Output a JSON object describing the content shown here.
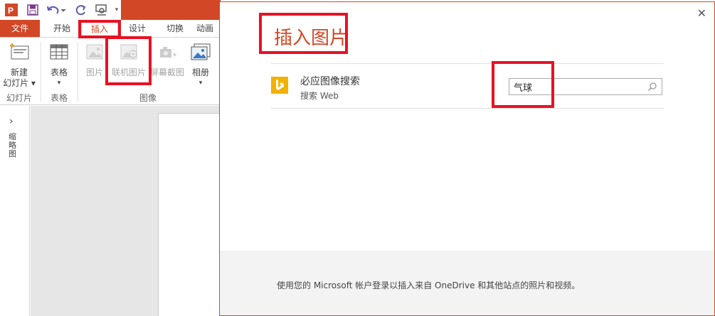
{
  "tabs": {
    "file": "文件",
    "home": "开始",
    "insert": "插入",
    "design": "设计",
    "transitions": "切换",
    "animations": "动画"
  },
  "ribbon": {
    "new_slide": [
      "新建",
      "幻灯片 ▾"
    ],
    "table": [
      "表格",
      "▾"
    ],
    "pictures": "图片",
    "online_pictures": "联机图片",
    "screenshot": "屏幕截图",
    "album": [
      "相册",
      "▾"
    ],
    "groups": {
      "slides": "幻灯片",
      "tables": "表格",
      "images": "图像"
    }
  },
  "left_pane": {
    "label": "缩略图"
  },
  "dialog": {
    "title": "插入图片",
    "bing": {
      "title": "必应图像搜索",
      "subtitle": "搜索 Web",
      "query": "气球"
    },
    "footer": "使用您的 Microsoft 帐户登录以插入来自 OneDrive 和其他站点的照片和视频。"
  },
  "colors": {
    "accent": "#d24726",
    "highlight": "#e81123",
    "bing": "#f2b200"
  }
}
